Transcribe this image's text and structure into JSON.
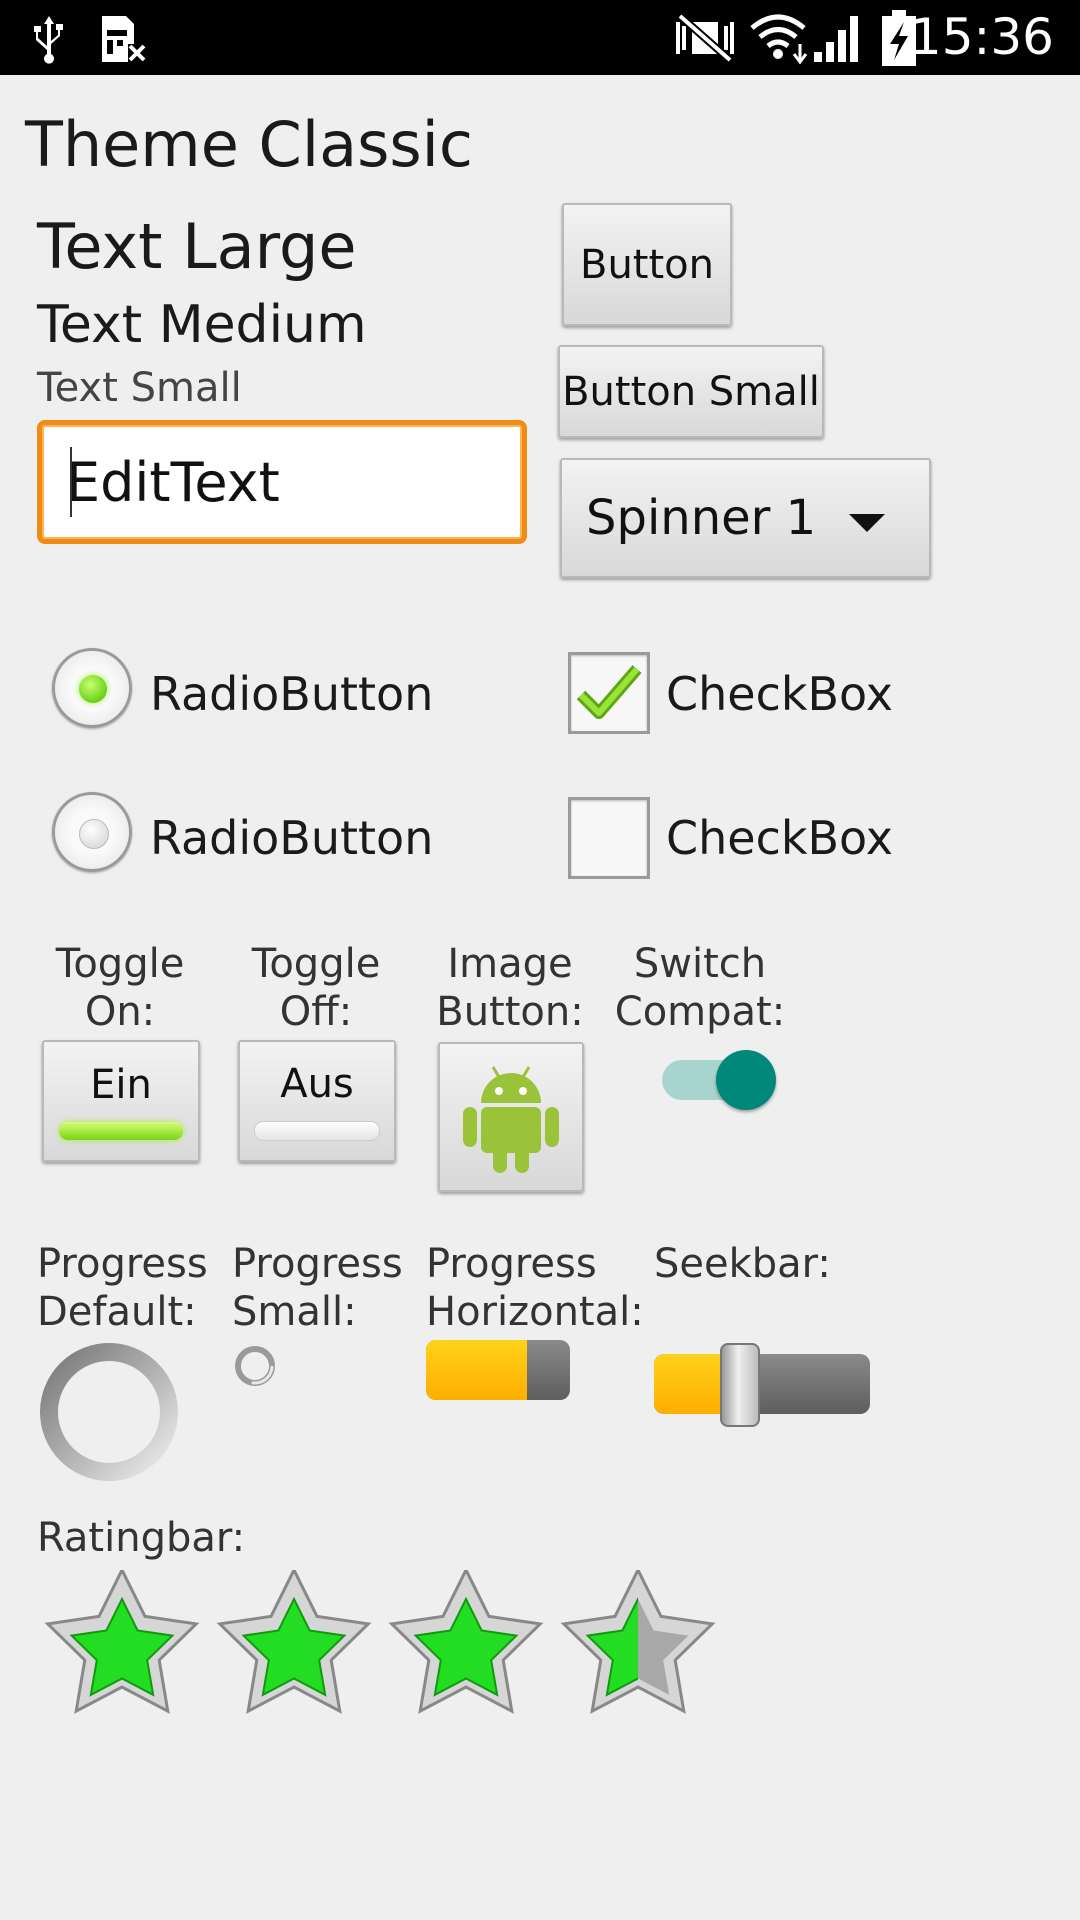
{
  "status_bar": {
    "time": "15:36",
    "icons": [
      "usb-icon",
      "sim-missing-icon",
      "mute-icon",
      "wifi-icon",
      "signal-icon",
      "battery-charging-icon"
    ]
  },
  "screen": {
    "title": "Theme Classic"
  },
  "text": {
    "large": "Text Large",
    "medium": "Text Medium",
    "small": "Text Small"
  },
  "buttons": {
    "button": "Button",
    "button_small": "Button Small"
  },
  "spinner": {
    "selected": "Spinner 1"
  },
  "edittext": {
    "value": "EditText"
  },
  "radios": [
    {
      "label": "RadioButton",
      "checked": true
    },
    {
      "label": "RadioButton",
      "checked": false
    }
  ],
  "checkboxes": [
    {
      "label": "CheckBox",
      "checked": true
    },
    {
      "label": "CheckBox",
      "checked": false
    }
  ],
  "toggles": {
    "on_label": "Toggle\nOn:",
    "on_text": "Ein",
    "off_label": "Toggle\nOff:",
    "off_text": "Aus"
  },
  "image_button": {
    "label": "Image\nButton:",
    "icon": "android-icon"
  },
  "switch": {
    "label": "Switch\nCompat:",
    "checked": true
  },
  "progress": {
    "default_label": "Progress\nDefault:",
    "small_label": "Progress\nSmall:",
    "horizontal_label": "Progress\nHorizontal:",
    "horizontal_value": 0.7
  },
  "seekbar": {
    "label": "Seekbar:",
    "value": 0.4
  },
  "ratingbar": {
    "label": "Ratingbar:",
    "max": 4,
    "rating": 3.5
  },
  "colors": {
    "accent_orange": "#f08c16",
    "progress_yellow": "#ffb800",
    "check_green": "#7cd314",
    "switch_teal": "#00897b",
    "star_green": "#22dd22"
  }
}
